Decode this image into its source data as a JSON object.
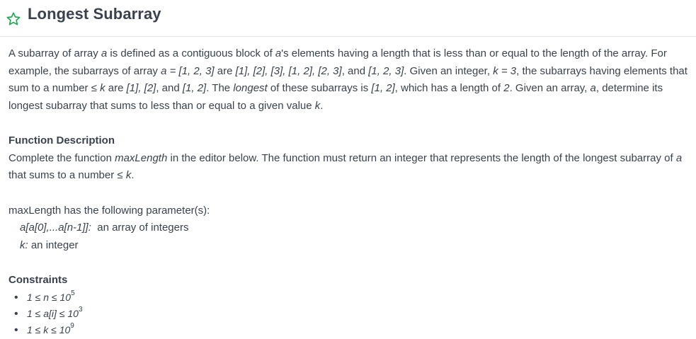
{
  "header": {
    "title": "Longest Subarray",
    "star_icon": "star-outline-icon",
    "accent": "#1ba94c"
  },
  "description": {
    "p1_s1": "A subarray of array ",
    "p1_a": "a",
    "p1_s2": " is defined as a contiguous block of ",
    "p1_a2": "a",
    "p1_s3": "'s elements having a length that is less than or equal to the length of the array. For example, the subarrays of array ",
    "p1_eq": "a = [1, 2, 3]",
    "p1_s4": " are ",
    "p1_list": "[1], [2], [3], [1, 2], [2, 3]",
    "p1_s5": ", and ",
    "p1_full": "[1, 2, 3]",
    "p1_s6": ". Given an integer, ",
    "p1_k": "k = 3",
    "p1_s7": ", the subarrays having elements that sum to a number ≤ ",
    "p1_k2": "k",
    "p1_s8": " are ",
    "p1_sub": "[1], [2]",
    "p1_s9": ", and ",
    "p1_sub2": "[1, 2]",
    "p1_s10": ". The ",
    "p1_longest": "longest",
    "p1_s11": " of these subarrays is ",
    "p1_res": "[1, 2]",
    "p1_s12": ", which has a length of ",
    "p1_two": "2",
    "p1_s13": ". Given an array, ",
    "p1_a3": "a",
    "p1_s14": ", determine its longest subarray that sums to less than or equal to a given value ",
    "p1_k3": "k",
    "p1_s15": "."
  },
  "function_description": {
    "heading": "Function Description",
    "s1": "Complete the function ",
    "fn": "maxLength",
    "s2": " in the editor below. The function must return an integer that represents the length of the longest subarray of ",
    "a": "a",
    "s3": " that sums to a number ≤ ",
    "k": "k",
    "s4": "."
  },
  "parameters": {
    "intro": "maxLength has the following parameter(s):",
    "p1_name": "a[a[0],...a[n-1]]:",
    "p1_desc": "  an array of integers",
    "p2_name": "k:",
    "p2_desc": " an integer"
  },
  "constraints": {
    "heading": "Constraints",
    "items": [
      {
        "base": "1 ≤ n ≤ 10",
        "exp": "5"
      },
      {
        "base": "1 ≤ a[i] ≤ 10",
        "exp": "3"
      },
      {
        "base": "1 ≤ k ≤ 10",
        "exp": "9"
      }
    ]
  }
}
